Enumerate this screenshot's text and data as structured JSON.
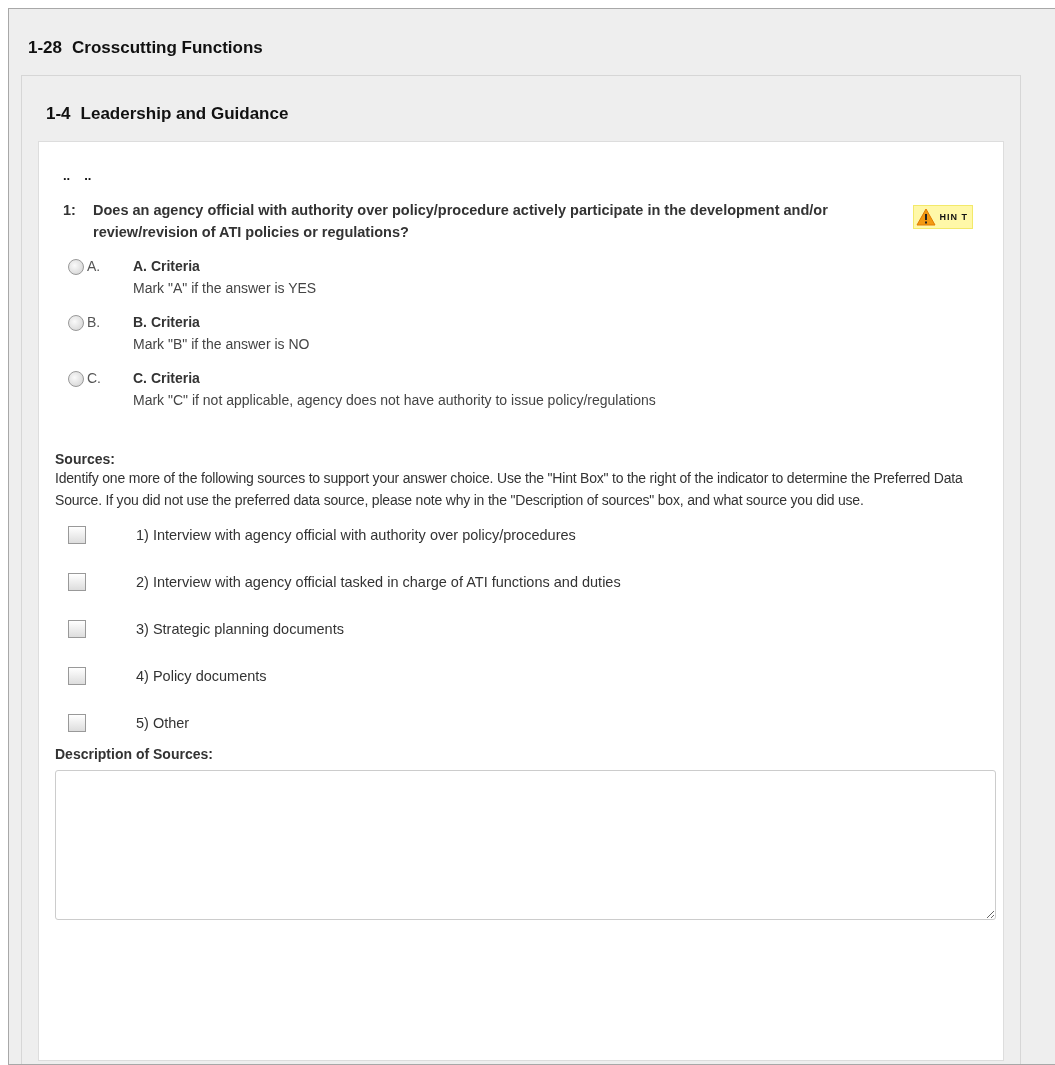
{
  "section": {
    "number": "1-28",
    "title": "Crosscutting Functions"
  },
  "subsection": {
    "number": "1-4",
    "title": "Leadership and Guidance"
  },
  "breadcrumb": [
    "..",
    ".."
  ],
  "question": {
    "number": "1:",
    "text": "Does an agency official with authority over policy/procedure actively participate in the development and/or review/revision of ATI policies or regulations?",
    "hint": "HIN T"
  },
  "options": [
    {
      "letter": "A.",
      "title": "A. Criteria",
      "description": "Mark \"A\" if the answer is YES",
      "selected": false
    },
    {
      "letter": "B.",
      "title": "B. Criteria",
      "description": "Mark \"B\" if the answer is NO",
      "selected": false
    },
    {
      "letter": "C.",
      "title": "C. Criteria",
      "description": "Mark \"C\" if not applicable, agency does not have authority to issue policy/regulations",
      "selected": false
    }
  ],
  "sources": {
    "heading": "Sources:",
    "instructions": "Identify one more of the following sources to support your answer choice. Use the \"Hint Box\" to the right of the indicator to determine the Preferred Data Source. If you did not use the preferred data source, please note why in the \"Description of sources\" box, and what source you did use.",
    "items": [
      {
        "label": "1) Interview with agency official with authority over policy/procedures",
        "checked": false
      },
      {
        "label": "2) Interview with agency official tasked in charge of ATI functions and duties",
        "checked": false
      },
      {
        "label": "3) Strategic planning documents",
        "checked": false
      },
      {
        "label": "4) Policy documents",
        "checked": false
      },
      {
        "label": "5) Other",
        "checked": false
      }
    ]
  },
  "description": {
    "label": "Description of Sources:"
  }
}
